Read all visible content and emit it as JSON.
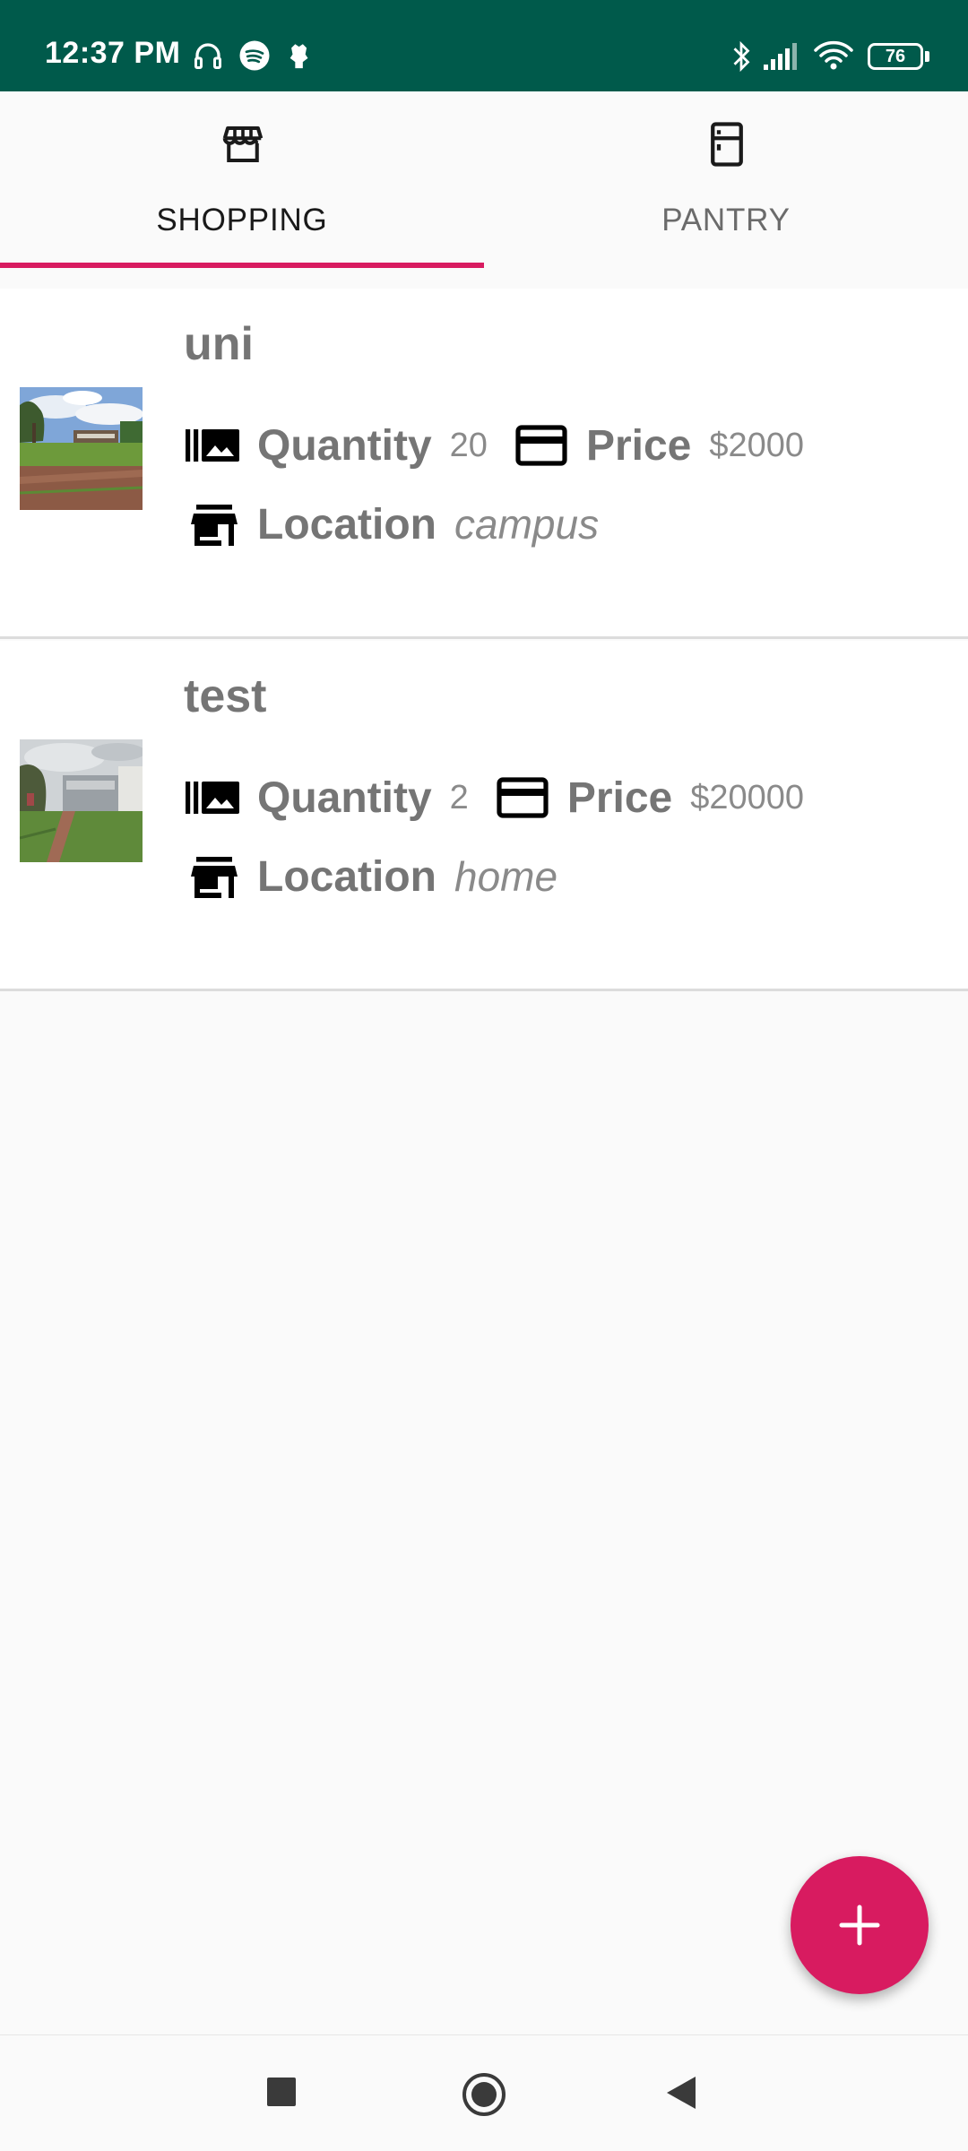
{
  "status_bar": {
    "time": "12:37 PM",
    "battery": "76",
    "left_icons": [
      "headphones-icon",
      "spotify-icon",
      "notification-icon"
    ],
    "right_icons": [
      "bluetooth-icon",
      "signal-icon",
      "wifi-icon",
      "battery-icon"
    ]
  },
  "tabs": [
    {
      "label": "SHOPPING",
      "icon": "store-icon",
      "active": true
    },
    {
      "label": "PANTRY",
      "icon": "fridge-icon",
      "active": false
    }
  ],
  "items": [
    {
      "name": "uni",
      "quantity_label": "Quantity",
      "quantity": "20",
      "price_label": "Price",
      "price": "$2000",
      "location_label": "Location",
      "location": "campus",
      "thumbnail": "campus-photo"
    },
    {
      "name": "test",
      "quantity_label": "Quantity",
      "quantity": "2",
      "price_label": "Price",
      "price": "$20000",
      "location_label": "Location",
      "location": "home",
      "thumbnail": "building-photo"
    }
  ],
  "fab": {
    "icon": "plus-icon"
  },
  "nav_bar": {
    "icons": [
      "recents-icon",
      "home-icon",
      "back-icon"
    ]
  },
  "colors": {
    "status_bar": "#005a4b",
    "accent": "#d81b60",
    "background": "#fafafa"
  }
}
